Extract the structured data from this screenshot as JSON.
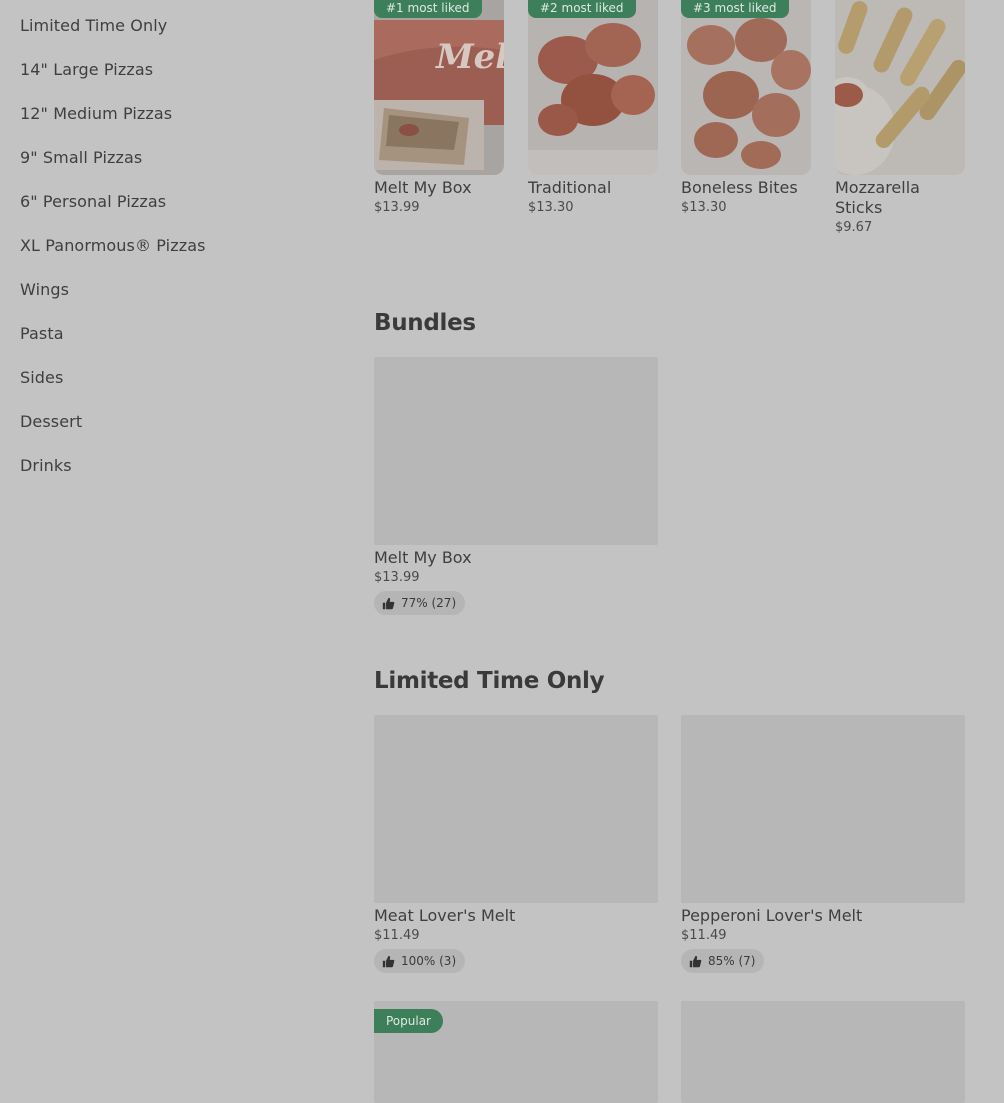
{
  "sidebar": {
    "items": [
      {
        "label": "Limited Time Only"
      },
      {
        "label": "14\" Large Pizzas"
      },
      {
        "label": "12\" Medium Pizzas"
      },
      {
        "label": "9\" Small Pizzas"
      },
      {
        "label": "6\" Personal Pizzas"
      },
      {
        "label": "XL Panormous® Pizzas"
      },
      {
        "label": "Wings"
      },
      {
        "label": "Pasta"
      },
      {
        "label": "Sides"
      },
      {
        "label": "Dessert"
      },
      {
        "label": "Drinks"
      }
    ]
  },
  "most_liked": [
    {
      "badge": "#1 most liked",
      "name": "Melt My Box",
      "price": "$13.99"
    },
    {
      "badge": "#2 most liked",
      "name": "Traditional",
      "price": "$13.30"
    },
    {
      "badge": "#3 most liked",
      "name": "Boneless Bites",
      "price": "$13.30"
    },
    {
      "name": "Mozzarella Sticks",
      "price": "$9.67"
    }
  ],
  "bundles": {
    "title": "Bundles",
    "items": [
      {
        "name": "Melt My Box",
        "price": "$13.99",
        "rating": "77% (27)"
      }
    ]
  },
  "limited": {
    "title": "Limited Time Only",
    "items": [
      {
        "name": "Meat Lover's Melt",
        "price": "$11.49",
        "rating": "100% (3)"
      },
      {
        "name": "Pepperoni Lover's Melt",
        "price": "$11.49",
        "rating": "85% (7)"
      },
      {
        "badge": "Popular"
      }
    ]
  },
  "icons": {
    "rating": "thumbs-up-icon"
  },
  "colors": {
    "badge_green": "#3c7f5a",
    "overlay_gray": "#c3c3c3"
  }
}
